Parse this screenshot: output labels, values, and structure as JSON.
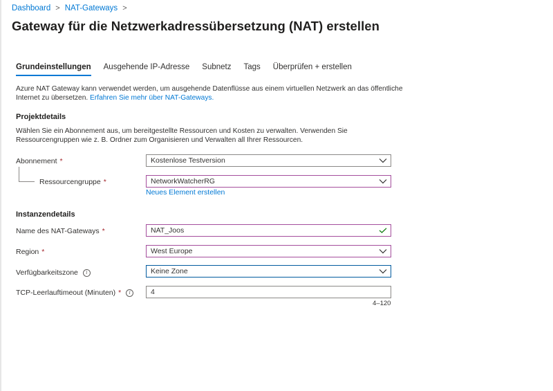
{
  "breadcrumb": {
    "items": [
      {
        "label": "Dashboard"
      },
      {
        "label": "NAT-Gateways"
      }
    ],
    "separator": ">"
  },
  "header": {
    "title": "Gateway für die Netzwerkadressübersetzung (NAT) erstellen",
    "more_label": "···"
  },
  "tabs": [
    {
      "label": "Grundeinstellungen",
      "active": true
    },
    {
      "label": "Ausgehende IP-Adresse",
      "active": false
    },
    {
      "label": "Subnetz",
      "active": false
    },
    {
      "label": "Tags",
      "active": false
    },
    {
      "label": "Überprüfen + erstellen",
      "active": false
    }
  ],
  "intro": {
    "text": "Azure NAT Gateway kann verwendet werden, um ausgehende Datenflüsse aus einem virtuellen Netzwerk an das öffentliche Internet zu übersetzen.",
    "link": "Erfahren Sie mehr über NAT-Gateways."
  },
  "project": {
    "title": "Projektdetails",
    "description": "Wählen Sie ein Abonnement aus, um bereitgestellte Ressourcen und Kosten zu verwalten. Verwenden Sie Ressourcengruppen wie z. B. Ordner zum Organisieren und Verwalten all Ihrer Ressourcen.",
    "subscription": {
      "label": "Abonnement",
      "required_mark": "*",
      "value": "Kostenlose Testversion"
    },
    "resource_group": {
      "label": "Ressourcengruppe",
      "required_mark": "*",
      "value": "NetworkWatcherRG",
      "new_link": "Neues Element erstellen"
    }
  },
  "instance": {
    "title": "Instanzendetails",
    "name": {
      "label": "Name des NAT-Gateways",
      "required_mark": "*",
      "value": "NAT_Joos"
    },
    "region": {
      "label": "Region",
      "required_mark": "*",
      "value": "West Europe"
    },
    "zone": {
      "label": "Verfügbarkeitszone",
      "info_icon": "i",
      "value": "Keine Zone"
    },
    "timeout": {
      "label": "TCP-Leerlauftimeout (Minuten)",
      "required_mark": "*",
      "info_icon": "i",
      "value": "4",
      "range_hint": "4–120"
    }
  },
  "colors": {
    "link": "#0078d4",
    "required": "#a4262c",
    "validation_border": "#a44d9c",
    "focus_border": "#005a9e",
    "valid_check": "#107c10"
  }
}
